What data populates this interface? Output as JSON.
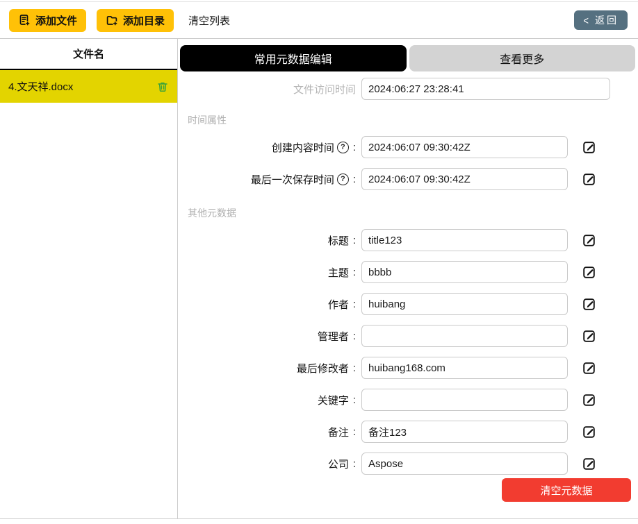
{
  "toolbar": {
    "add_file_label": "添加文件",
    "add_dir_label": "添加目录",
    "clear_list_label": "清空列表",
    "back_chevron": "<",
    "back_label": "返回"
  },
  "sidebar": {
    "header": "文件名",
    "files": [
      {
        "name": "4.文天祥.docx"
      }
    ]
  },
  "tabs": {
    "edit_label": "常用元数据编辑",
    "more_label": "查看更多"
  },
  "form": {
    "colon": ":",
    "access": {
      "label": "文件访问时间",
      "value": "2024:06:27 23:28:41"
    },
    "section_time": "时间属性",
    "section_other": "其他元数据",
    "rows": [
      {
        "label": "创建内容时间",
        "help": "?",
        "value": "2024:06:07 09:30:42Z"
      },
      {
        "label": "最后一次保存时间",
        "help": "?",
        "value": "2024:06:07 09:30:42Z"
      },
      {
        "label": "标题",
        "value": "title123"
      },
      {
        "label": "主题",
        "value": "bbbb"
      },
      {
        "label": "作者",
        "value": "huibang"
      },
      {
        "label": "管理者",
        "value": ""
      },
      {
        "label": "最后修改者",
        "value": "huibang168.com"
      },
      {
        "label": "关键字",
        "value": ""
      },
      {
        "label": "备注",
        "value": "备注123"
      },
      {
        "label": "公司",
        "value": "Aspose"
      }
    ],
    "clear_metadata_label": "清空元数据"
  },
  "colors": {
    "accent_yellow": "#ffc107",
    "selected_item_yellow": "#e3d400",
    "back_button_slate": "#557080",
    "danger_red": "#f23c30",
    "trash_green": "#3aa23a",
    "tab_active_bg": "#000000",
    "tab_inactive_bg": "#d3d3d3"
  }
}
